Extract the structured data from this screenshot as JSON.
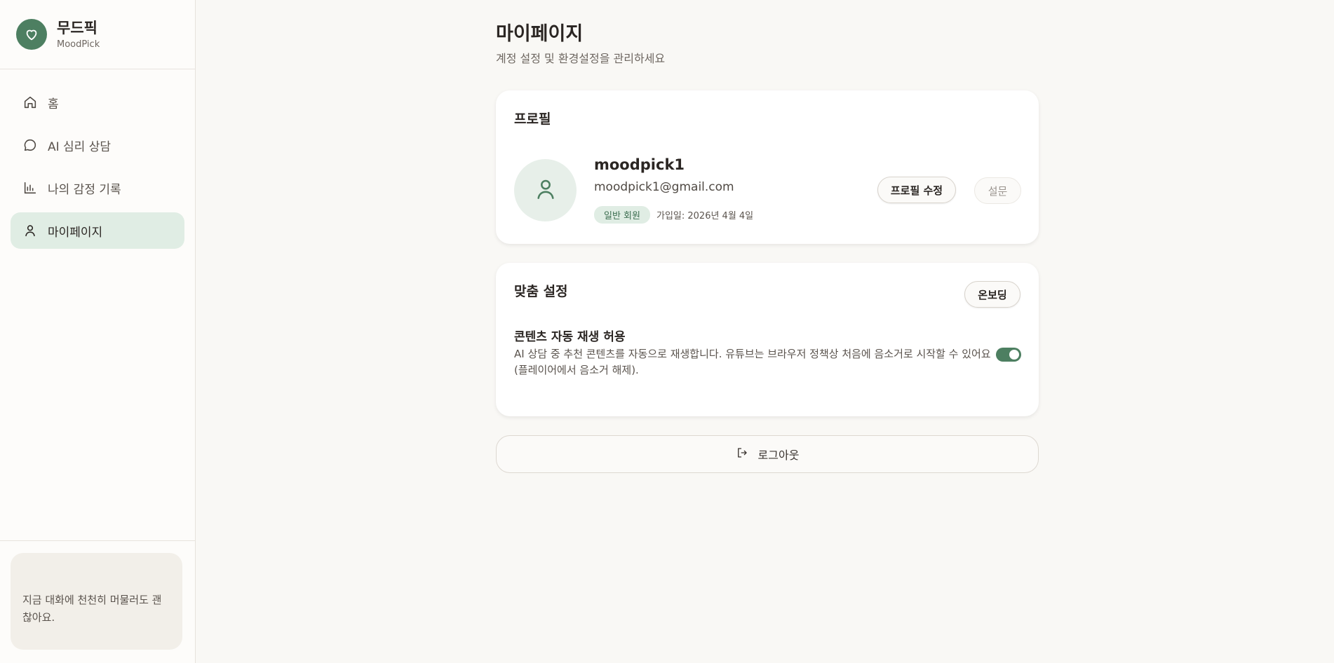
{
  "brand": {
    "name": "무드픽",
    "subtitle": "MoodPick",
    "icon": "heart-icon"
  },
  "sidebar": {
    "items": [
      {
        "label": "홈",
        "icon": "home-icon",
        "active": false
      },
      {
        "label": "AI 심리 상담",
        "icon": "chat-bubble-icon",
        "active": false
      },
      {
        "label": "나의 감정 기록",
        "icon": "bar-chart-icon",
        "active": false
      },
      {
        "label": "마이페이지",
        "icon": "user-icon",
        "active": true
      }
    ],
    "note": "지금 대화에 천천히 머물러도 괜찮아요."
  },
  "page": {
    "title": "마이페이지",
    "subtitle": "계정 설정 및 환경설정을 관리하세요"
  },
  "profile": {
    "section_title": "프로필",
    "username": "moodpick1",
    "email": "moodpick1@gmail.com",
    "badge": "일반 회원",
    "joined": "가입일: 2026년 4월 4일",
    "edit_label": "프로필 수정",
    "survey_label": "설문"
  },
  "settings": {
    "section_title": "맞춤 설정",
    "onboarding_label": "온보딩",
    "autoplay_title": "콘텐츠 자동 재생 허용",
    "autoplay_desc": "AI 상담 중 추천 콘텐츠를 자동으로 재생합니다. 유튜브는 브라우저 정책상 처음에 음소거로 시작할 수 있어요 (플레이어에서 음소거 해제).",
    "autoplay_enabled": true
  },
  "logout": {
    "label": "로그아웃",
    "icon": "logout-icon"
  },
  "colors": {
    "accent": "#4d7f61",
    "active_bg": "#e0ede4",
    "background": "#f9f8f5"
  }
}
